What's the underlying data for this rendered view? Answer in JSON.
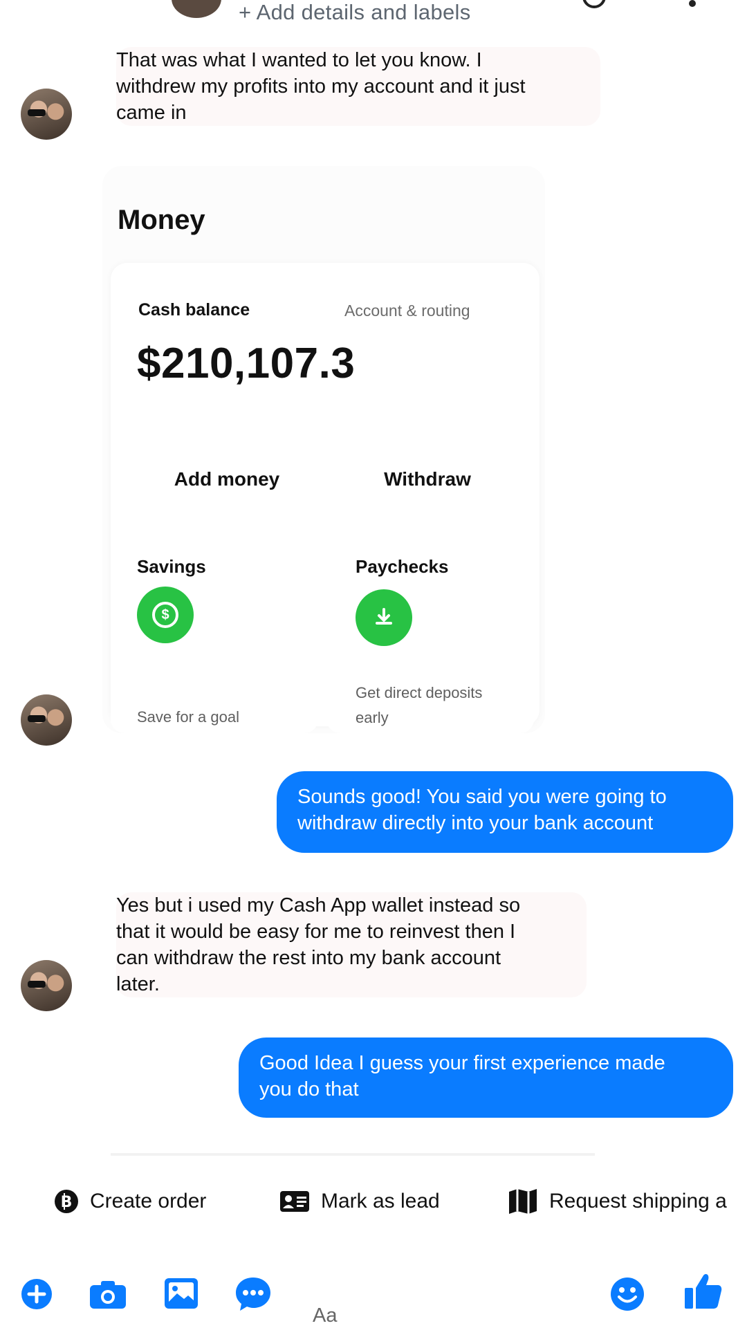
{
  "header": {
    "subtitle": "+ Add details and labels"
  },
  "messages": {
    "received_1": {
      "lines": [
        "That was what I wanted to let you know. I",
        "withdrew my profits into my account and it just",
        "came in"
      ]
    },
    "money_card": {
      "title": "Money",
      "cash_balance_label": "Cash balance",
      "account_routing": "Account & routing",
      "balance": "$210,107.3",
      "add_money": "Add money",
      "withdraw": "Withdraw",
      "savings_title": "Savings",
      "savings_desc": "Save for a goal",
      "paychecks_title": "Paychecks",
      "paychecks_desc_1": "Get direct deposits",
      "paychecks_desc_2": "early",
      "accent": "#28c244"
    },
    "sent_1": {
      "lines": [
        "Sounds good! You said you were going to",
        "withdraw directly into your bank account"
      ]
    },
    "received_2": {
      "lines": [
        "Yes but i used my Cash App wallet instead so",
        "that it would be easy for me to reinvest then I",
        "can withdraw the rest into my bank account",
        "later."
      ]
    },
    "sent_2": {
      "lines": [
        "Good Idea I guess your first experience made",
        "you do that"
      ]
    }
  },
  "quick_actions": {
    "create_order": "Create order",
    "mark_as_lead": "Mark as lead",
    "request_shipping": "Request shipping a"
  },
  "composer": {
    "placeholder": "Aa",
    "icons": [
      "plus-icon",
      "camera-icon",
      "gallery-icon",
      "chat-icon",
      "emoji-icon",
      "thumbs-up-icon"
    ],
    "accent": "#0a7cff"
  }
}
